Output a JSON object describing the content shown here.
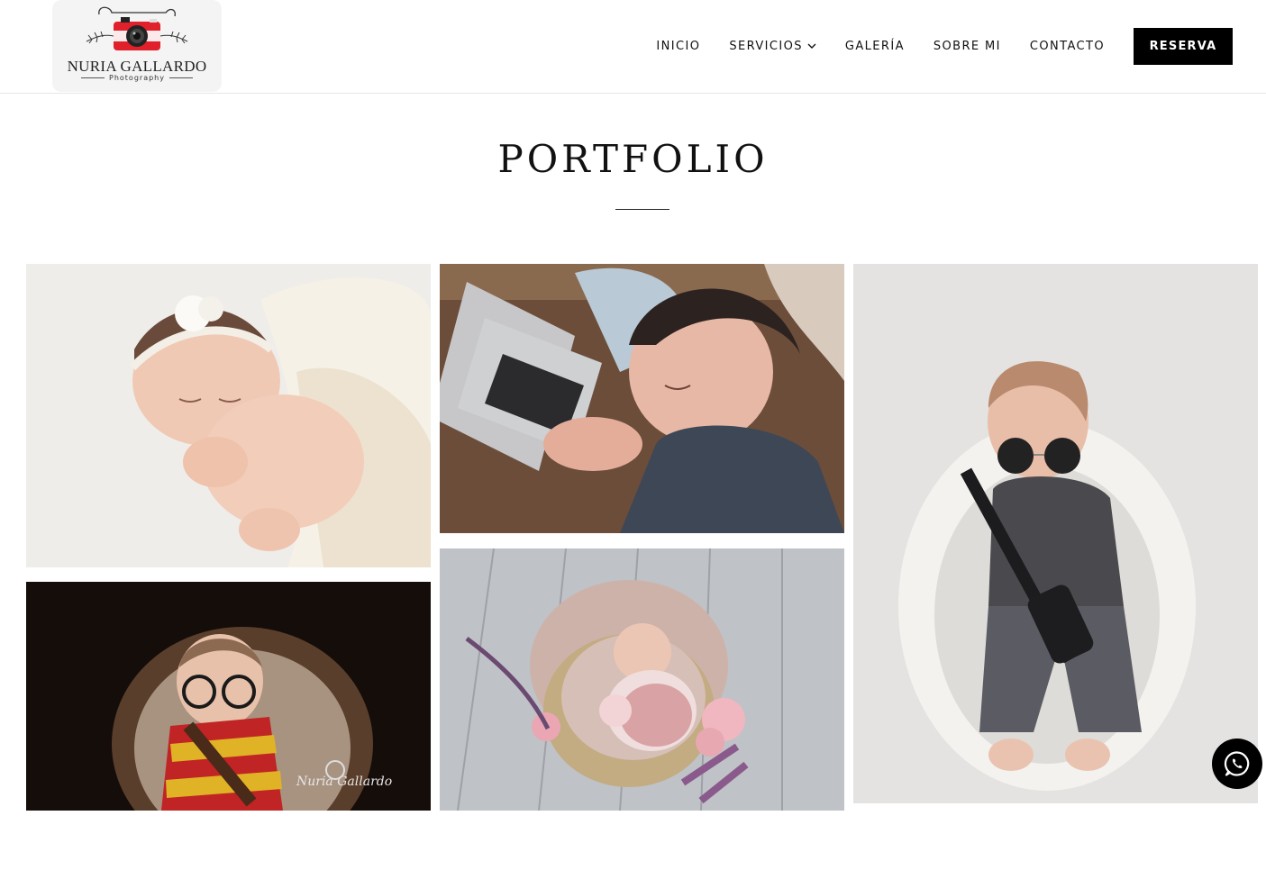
{
  "logo": {
    "name": "NURIA GALLARDO",
    "subtitle": "Photography",
    "icon": "camera-logo-icon"
  },
  "nav": {
    "items": [
      {
        "label": "INICIO"
      },
      {
        "label": "SERVICIOS",
        "has_dropdown": true
      },
      {
        "label": "GALERÍA"
      },
      {
        "label": "SOBRE MI"
      },
      {
        "label": "CONTACTO"
      }
    ],
    "cta_label": "RESERVA"
  },
  "page": {
    "title": "PORTFOLIO"
  },
  "gallery": {
    "photos": [
      {
        "subject": "newborn-flower-headband"
      },
      {
        "subject": "newborn-laptop"
      },
      {
        "subject": "newborn-sunglasses-guitar"
      },
      {
        "subject": "newborn-glasses-scarf"
      },
      {
        "subject": "newborn-basket-flowers"
      }
    ],
    "watermark": "Nuria Gallardo"
  },
  "floating": {
    "icon": "whatsapp-icon"
  },
  "colors": {
    "accent": "#000000",
    "logo_red": "#e0202a",
    "background": "#ffffff"
  }
}
